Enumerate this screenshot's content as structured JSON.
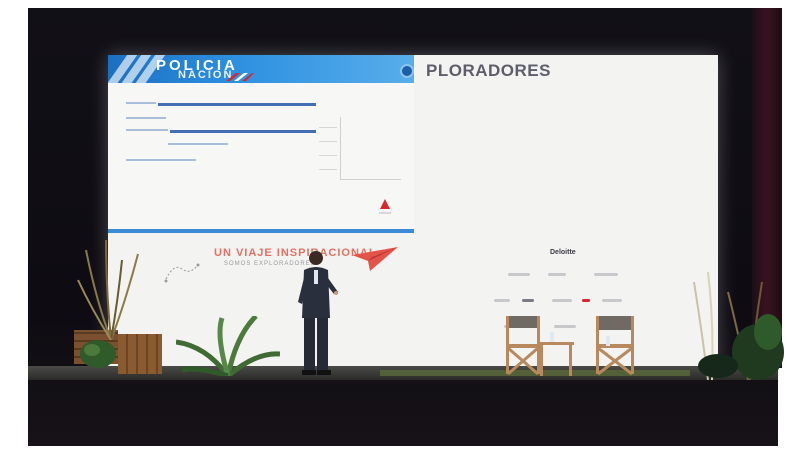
{
  "scene": {
    "description_kind": "photo",
    "screen": {
      "slide_left_logo": "POLICIA",
      "slide_left_logo_sub": "NACION",
      "slide_right_title": "PLORADORES",
      "headline": "UN VIAJE INSPIRACIONAL",
      "subline": "SOMOS EXPLORADORES",
      "brand_word": "Deloitte"
    }
  }
}
